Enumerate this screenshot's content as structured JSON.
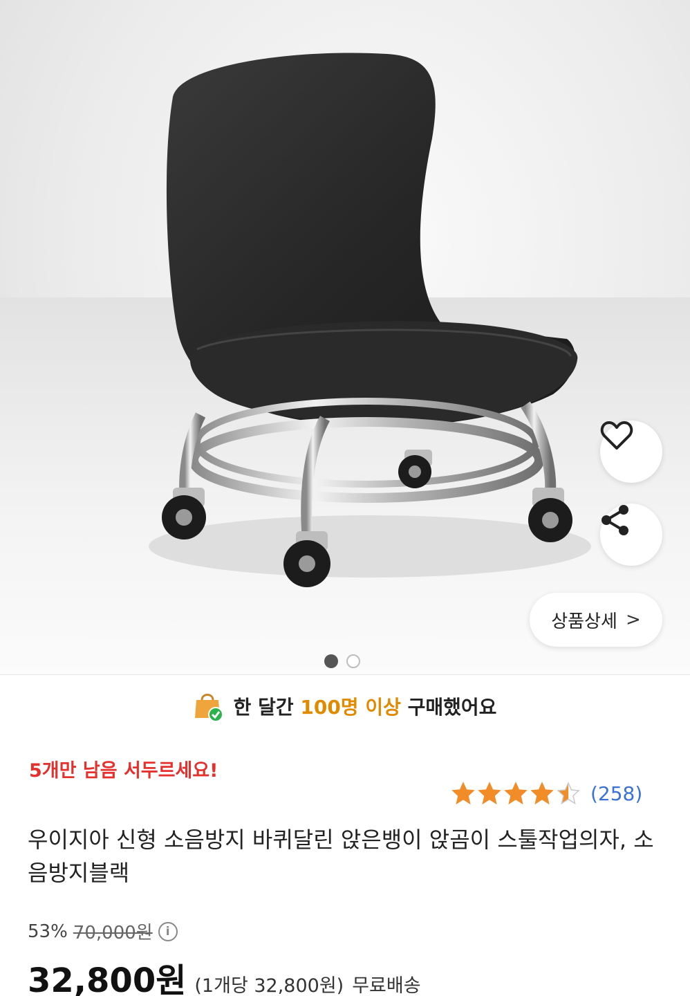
{
  "image": {
    "alt_icon": "chair-product-photo",
    "carousel_total": 2,
    "carousel_active": 1
  },
  "actions": {
    "wishlist_icon": "heart-icon",
    "share_icon": "share-icon",
    "detail_label": "상품상세",
    "detail_chevron": ">"
  },
  "purchase_banner": {
    "prefix": "한 달간 ",
    "highlight": "100명 이상",
    "suffix": " 구매했어요",
    "highlight_color": "#e08a00"
  },
  "urgency": {
    "text": "5개만 남음 서두르세요!",
    "color": "#e4312e"
  },
  "rating": {
    "stars": 4.5,
    "max": 5,
    "count": "(258)",
    "star_color": "#f28c28"
  },
  "product": {
    "title": "우이지아 신형 소음방지 바퀴달린 앉은뱅이 앉곰이 스툴작업의자, 소음방지블랙"
  },
  "price": {
    "discount": "53%",
    "original": "70,000원",
    "info_icon": "i",
    "final": "32,800원",
    "unit": "(1개당 32,800원)",
    "shipping": "무료배송"
  }
}
